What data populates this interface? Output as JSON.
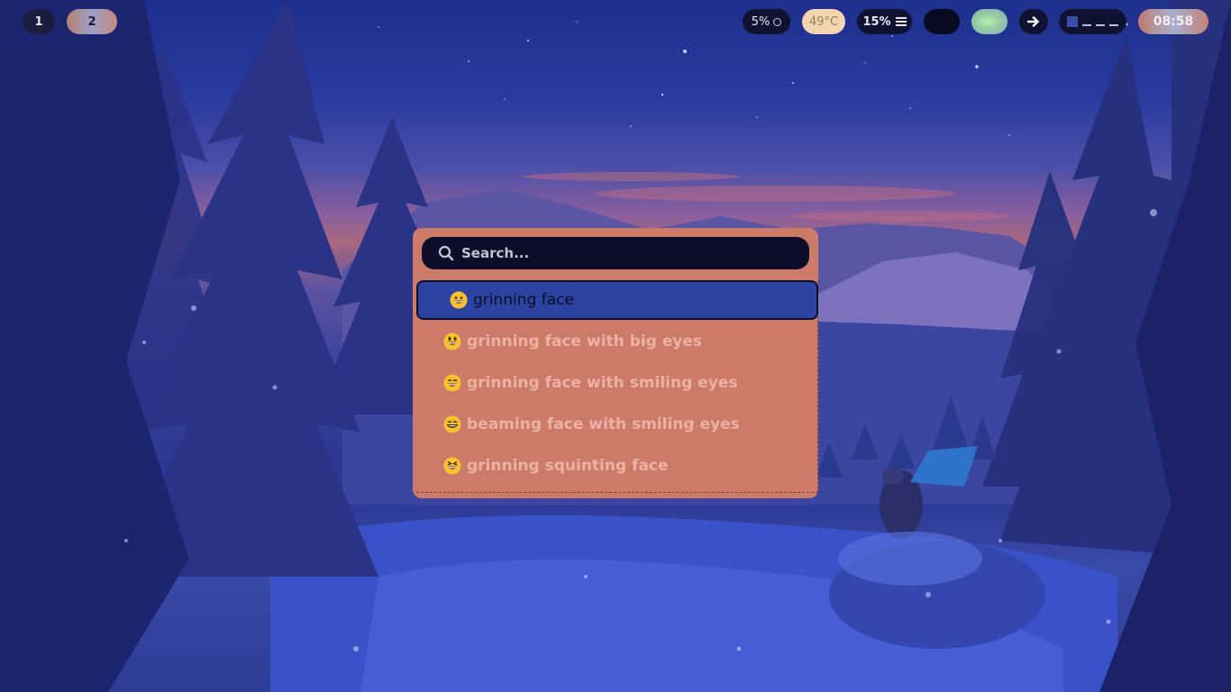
{
  "topbar": {
    "workspaces": [
      "1",
      "2"
    ],
    "cpu_label": "5%",
    "temperature": "49°C",
    "memory_label": "15%",
    "clock": "08:58",
    "icons": [
      "circle-icon",
      "menu-icon",
      "arrow-right-icon"
    ]
  },
  "launcher": {
    "search_placeholder": "Search...",
    "items": [
      {
        "label": "grinning face",
        "emoji": "grinning-face"
      },
      {
        "label": "grinning face with big eyes",
        "emoji": "grinning-face-with-big-eyes"
      },
      {
        "label": "grinning face with smiling eyes",
        "emoji": "grinning-face-with-smiling-eyes"
      },
      {
        "label": "beaming face with smiling eyes",
        "emoji": "beaming-face-with-smiling-eyes"
      },
      {
        "label": "grinning squinting face",
        "emoji": "grinning-squinting-face"
      }
    ],
    "selected_index": 0
  },
  "colors": {
    "launcher_bg": "#cd7b69",
    "search_bg": "#0d0e2a",
    "selection_bg": "#2c43a3",
    "item_text": "#ecb1a4",
    "bar_dark": "#0f1230"
  }
}
